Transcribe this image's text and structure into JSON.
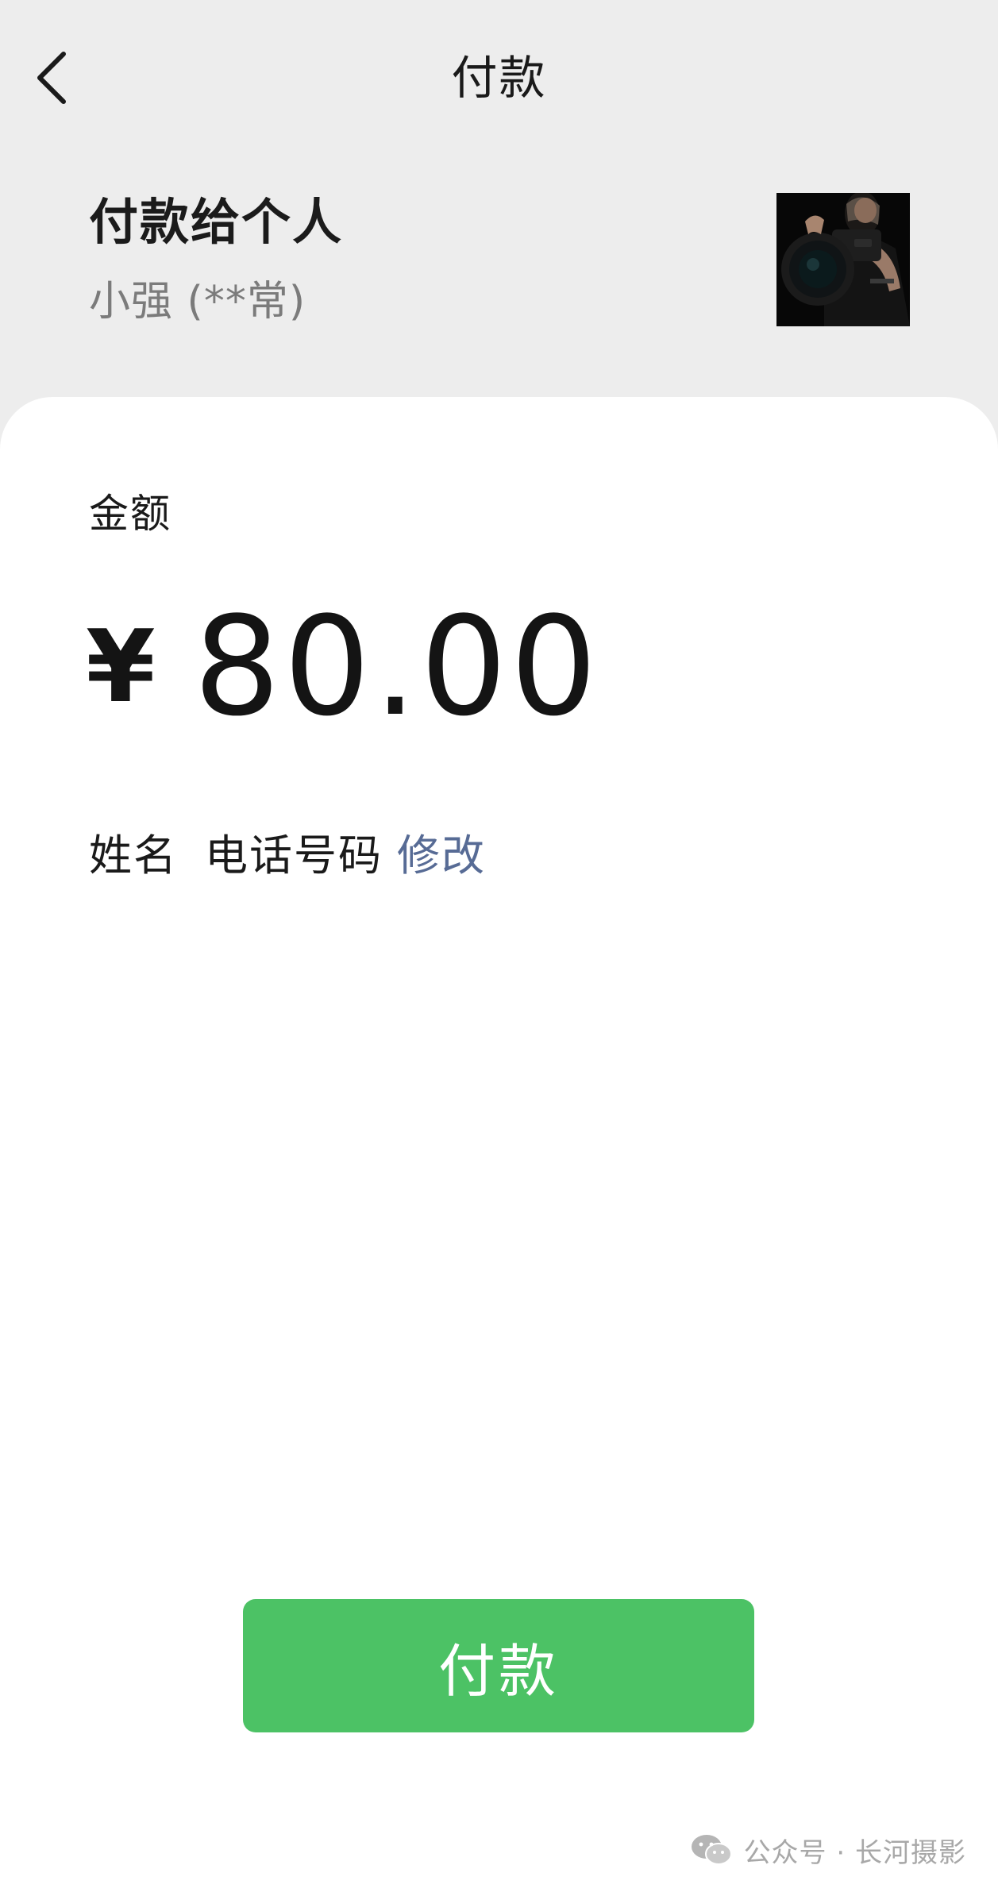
{
  "nav": {
    "title": "付款",
    "back_icon": "chevron-left-icon"
  },
  "payee": {
    "title": "付款给个人",
    "name": "小强 (**常)",
    "avatar_icon": "photographer-avatar"
  },
  "amount": {
    "label": "金额",
    "currency": "¥",
    "value": "80.00"
  },
  "info": {
    "name_label": "姓名",
    "phone_label": "电话号码",
    "modify_label": "修改"
  },
  "pay_button": {
    "label": "付款"
  },
  "watermark": {
    "text": "公众号 · 长河摄影",
    "icon": "wechat-icon"
  },
  "colors": {
    "background": "#ededed",
    "card": "#ffffff",
    "primary_green": "#4cc265",
    "link_blue": "#576b95",
    "secondary_text": "#7b7b7b"
  }
}
